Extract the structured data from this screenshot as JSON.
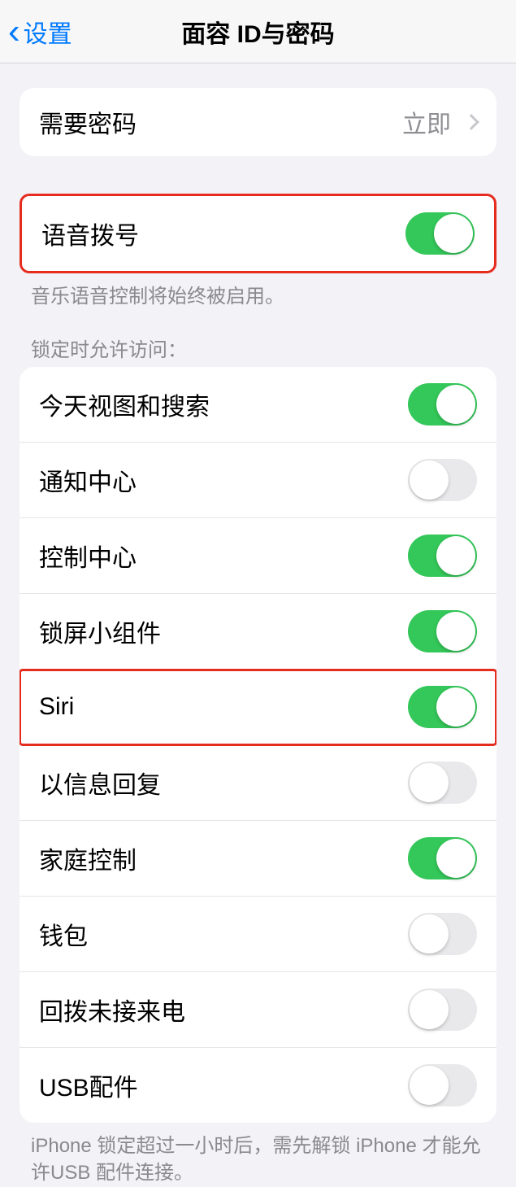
{
  "nav": {
    "back_label": "设置",
    "title": "面容 ID与密码"
  },
  "passcode_row": {
    "label": "需要密码",
    "value": "立即"
  },
  "voice_dial": {
    "label": "语音拨号",
    "on": true,
    "footer": "音乐语音控制将始终被启用。"
  },
  "lock_access": {
    "header": "锁定时允许访问：",
    "items": [
      {
        "label": "今天视图和搜索",
        "on": true,
        "highlight": false
      },
      {
        "label": "通知中心",
        "on": false,
        "highlight": false
      },
      {
        "label": "控制中心",
        "on": true,
        "highlight": false
      },
      {
        "label": "锁屏小组件",
        "on": true,
        "highlight": false
      },
      {
        "label": "Siri",
        "on": true,
        "highlight": true
      },
      {
        "label": "以信息回复",
        "on": false,
        "highlight": false
      },
      {
        "label": "家庭控制",
        "on": true,
        "highlight": false
      },
      {
        "label": "钱包",
        "on": false,
        "highlight": false
      },
      {
        "label": "回拨未接来电",
        "on": false,
        "highlight": false
      },
      {
        "label": "USB配件",
        "on": false,
        "highlight": false
      }
    ],
    "footer": "iPhone 锁定超过一小时后，需先解锁 iPhone 才能允许USB 配件连接。"
  }
}
